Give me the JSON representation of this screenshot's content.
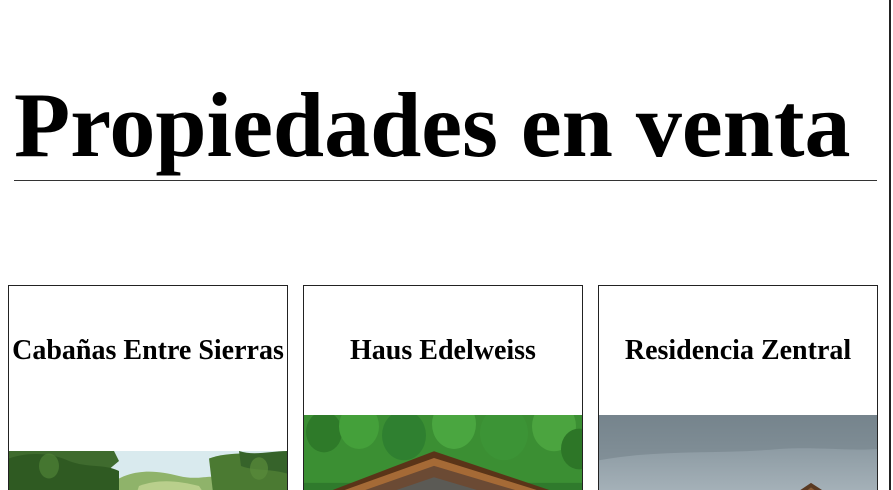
{
  "page": {
    "title": "Propiedades en venta"
  },
  "properties": [
    {
      "name": "Cabañas Entre Sierras",
      "image": "forest-cabin-photo"
    },
    {
      "name": "Haus Edelweiss",
      "image": "alpine-chalet-photo"
    },
    {
      "name": "Residencia Zentral",
      "image": "mountain-residence-photo"
    }
  ],
  "colors": {
    "text": "#000000",
    "border": "#222222",
    "background": "#ffffff"
  }
}
